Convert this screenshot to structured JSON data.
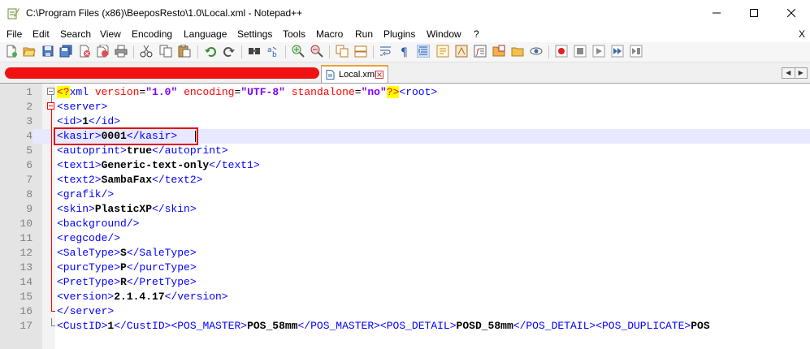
{
  "window": {
    "title": "C:\\Program Files (x86)\\BeeposResto\\1.0\\Local.xml - Notepad++"
  },
  "menu": {
    "items": [
      "File",
      "Edit",
      "Search",
      "View",
      "Encoding",
      "Language",
      "Settings",
      "Tools",
      "Macro",
      "Run",
      "Plugins",
      "Window",
      "?"
    ],
    "close_label": "X"
  },
  "tabs": {
    "active_label": "Local.xml"
  },
  "editor": {
    "line_numbers": [
      "1",
      "2",
      "3",
      "4",
      "5",
      "6",
      "7",
      "8",
      "9",
      "10",
      "11",
      "12",
      "13",
      "14",
      "15",
      "16",
      "17"
    ],
    "current_line": 4,
    "lines": [
      [
        {
          "c": "t-pi",
          "t": "<?"
        },
        {
          "c": "t-tag",
          "t": "xml "
        },
        {
          "c": "t-attr",
          "t": "version"
        },
        {
          "c": "t-op",
          "t": "="
        },
        {
          "c": "t-val",
          "t": "\"1.0\""
        },
        {
          "c": "t-op",
          "t": " "
        },
        {
          "c": "t-attr",
          "t": "encoding"
        },
        {
          "c": "t-op",
          "t": "="
        },
        {
          "c": "t-val",
          "t": "\"UTF-8\""
        },
        {
          "c": "t-op",
          "t": " "
        },
        {
          "c": "t-attr",
          "t": "standalone"
        },
        {
          "c": "t-op",
          "t": "="
        },
        {
          "c": "t-val",
          "t": "\"no\""
        },
        {
          "c": "t-pi",
          "t": "?>"
        },
        {
          "c": "t-tag",
          "t": "<root>"
        }
      ],
      [
        {
          "c": "t-tag",
          "t": "<server>"
        }
      ],
      [
        {
          "c": "t-tag",
          "t": "<id>"
        },
        {
          "c": "t-txt",
          "t": "1"
        },
        {
          "c": "t-tag",
          "t": "</id>"
        }
      ],
      [
        {
          "c": "t-tag",
          "t": "<kasir>"
        },
        {
          "c": "t-txt",
          "t": "0001"
        },
        {
          "c": "t-tag",
          "t": "</kasir>"
        }
      ],
      [
        {
          "c": "t-tag",
          "t": "<autoprint>"
        },
        {
          "c": "t-txt",
          "t": "true"
        },
        {
          "c": "t-tag",
          "t": "</autoprint>"
        }
      ],
      [
        {
          "c": "t-tag",
          "t": "<text1>"
        },
        {
          "c": "t-txt",
          "t": "Generic-text-only"
        },
        {
          "c": "t-tag",
          "t": "</text1>"
        }
      ],
      [
        {
          "c": "t-tag",
          "t": "<text2>"
        },
        {
          "c": "t-txt",
          "t": "SambaFax"
        },
        {
          "c": "t-tag",
          "t": "</text2>"
        }
      ],
      [
        {
          "c": "t-tag",
          "t": "<grafik/>"
        }
      ],
      [
        {
          "c": "t-tag",
          "t": "<skin>"
        },
        {
          "c": "t-txt",
          "t": "PlasticXP"
        },
        {
          "c": "t-tag",
          "t": "</skin>"
        }
      ],
      [
        {
          "c": "t-tag",
          "t": "<background/>"
        }
      ],
      [
        {
          "c": "t-tag",
          "t": "<regcode/>"
        }
      ],
      [
        {
          "c": "t-tag",
          "t": "<SaleType>"
        },
        {
          "c": "t-txt",
          "t": "S"
        },
        {
          "c": "t-tag",
          "t": "</SaleType>"
        }
      ],
      [
        {
          "c": "t-tag",
          "t": "<purcType>"
        },
        {
          "c": "t-txt",
          "t": "P"
        },
        {
          "c": "t-tag",
          "t": "</purcType>"
        }
      ],
      [
        {
          "c": "t-tag",
          "t": "<PretType>"
        },
        {
          "c": "t-txt",
          "t": "R"
        },
        {
          "c": "t-tag",
          "t": "</PretType>"
        }
      ],
      [
        {
          "c": "t-tag",
          "t": "<version>"
        },
        {
          "c": "t-txt",
          "t": "2.1.4.17"
        },
        {
          "c": "t-tag",
          "t": "</version>"
        }
      ],
      [
        {
          "c": "t-tag",
          "t": "</server>"
        }
      ],
      [
        {
          "c": "t-tag",
          "t": "<CustID>"
        },
        {
          "c": "t-txt",
          "t": "1"
        },
        {
          "c": "t-tag",
          "t": "</CustID>"
        },
        {
          "c": "t-tag",
          "t": "<POS_MASTER>"
        },
        {
          "c": "t-txt",
          "t": "POS_58mm"
        },
        {
          "c": "t-tag",
          "t": "</POS_MASTER>"
        },
        {
          "c": "t-tag",
          "t": "<POS_DETAIL>"
        },
        {
          "c": "t-txt",
          "t": "POSD_58mm"
        },
        {
          "c": "t-tag",
          "t": "</POS_DETAIL>"
        },
        {
          "c": "t-tag",
          "t": "<POS_DUPLICATE>"
        },
        {
          "c": "t-txt",
          "t": "POS"
        }
      ]
    ]
  },
  "colors": {
    "tag": "#0000ff",
    "attribute": "#ff0000",
    "value": "#8000ff",
    "fold_marker": "#ff0000",
    "highlight_box": "#e01010",
    "redaction": "#f01212"
  },
  "toolbar": {
    "icons": [
      "new-file-icon",
      "open-file-icon",
      "save-icon",
      "save-all-icon",
      "close-icon",
      "close-all-icon",
      "print-icon",
      "cut-icon",
      "copy-icon",
      "paste-icon",
      "undo-icon",
      "redo-icon",
      "find-icon",
      "replace-icon",
      "zoom-in-icon",
      "zoom-out-icon",
      "sync-vertical-icon",
      "sync-horizontal-icon",
      "word-wrap-icon",
      "show-all-chars-icon",
      "indent-guide-icon",
      "user-language-icon",
      "doc-map-icon",
      "function-list-icon",
      "folder-workspace-icon",
      "monitor-icon",
      "record-macro-icon",
      "stop-macro-icon",
      "play-macro-icon",
      "run-macro-multiple-icon",
      "save-macro-icon"
    ]
  }
}
